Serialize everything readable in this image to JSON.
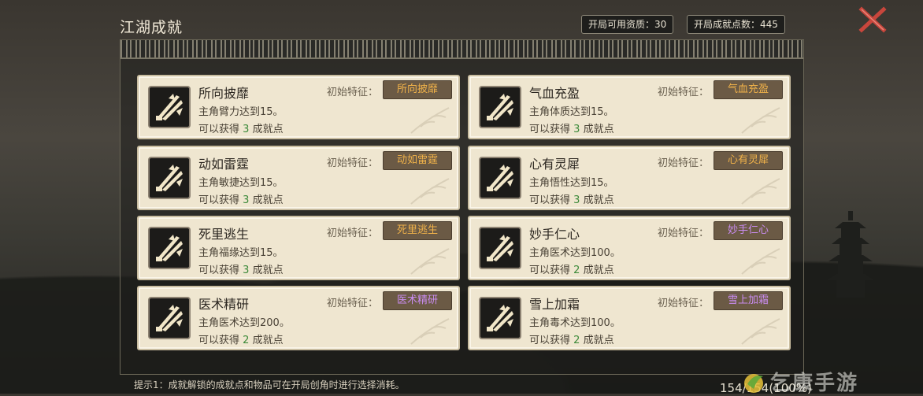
{
  "header": {
    "title": "江湖成就",
    "stat_start_points_label": "开局可用资质：",
    "stat_start_points_value": "30",
    "stat_achievement_label": "开局成就点数：",
    "stat_achievement_value": "445"
  },
  "trait_prefix": "初始特征：",
  "reward_prefix": "可以获得",
  "reward_suffix": "成就点",
  "cards": [
    {
      "name": "所向披靡",
      "desc": "主角臂力达到15。",
      "points": "3",
      "trait": "所向披靡",
      "trait_color": "#f0b24a"
    },
    {
      "name": "气血充盈",
      "desc": "主角体质达到15。",
      "points": "3",
      "trait": "气血充盈",
      "trait_color": "#f0b24a"
    },
    {
      "name": "动如雷霆",
      "desc": "主角敏捷达到15。",
      "points": "3",
      "trait": "动如雷霆",
      "trait_color": "#f0b24a"
    },
    {
      "name": "心有灵犀",
      "desc": "主角悟性达到15。",
      "points": "3",
      "trait": "心有灵犀",
      "trait_color": "#f0b24a"
    },
    {
      "name": "死里逃生",
      "desc": "主角福缘达到15。",
      "points": "3",
      "trait": "死里逃生",
      "trait_color": "#f0b24a"
    },
    {
      "name": "妙手仁心",
      "desc": "主角医术达到100。",
      "points": "2",
      "trait": "妙手仁心",
      "trait_color": "#c98cf0"
    },
    {
      "name": "医术精研",
      "desc": "主角医术达到200。",
      "points": "2",
      "trait": "医术精研",
      "trait_color": "#c98cf0"
    },
    {
      "name": "雪上加霜",
      "desc": "主角毒术达到100。",
      "points": "2",
      "trait": "雪上加霜",
      "trait_color": "#c98cf0"
    }
  ],
  "footer": {
    "hint": "提示1：成就解锁的成就点和物品可在开局创角时进行选择消耗。",
    "progress": "154/154(100%)"
  },
  "watermark": "乞康手游"
}
